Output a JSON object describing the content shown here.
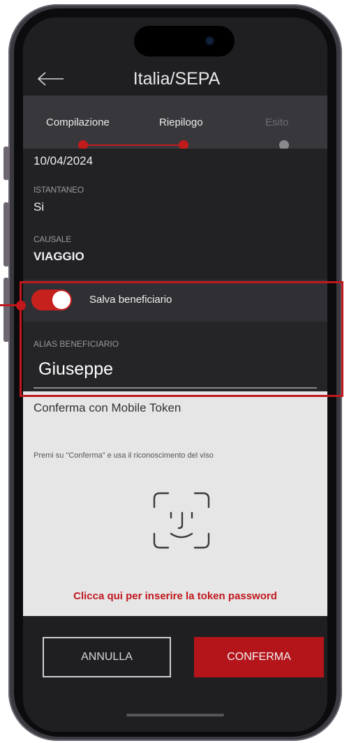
{
  "header": {
    "title": "Italia/SEPA",
    "back_icon": "arrow-left-icon"
  },
  "steps": [
    {
      "label": "Compilazione",
      "state": "done"
    },
    {
      "label": "Riepilogo",
      "state": "active"
    },
    {
      "label": "Esito",
      "state": "pending"
    }
  ],
  "summary": {
    "date": "10/04/2024",
    "instant_label": "ISTANTANEO",
    "instant_value": "Si",
    "reason_label": "CAUSALE",
    "reason_value": "VIAGGIO"
  },
  "save_beneficiary": {
    "label": "Salva beneficiario",
    "enabled": true
  },
  "alias": {
    "label": "ALIAS BENEFICIARIO",
    "value": "Giuseppe"
  },
  "token": {
    "title": "Conferma con Mobile Token",
    "hint": "Premi su \"Conferma\" e usa il riconoscimento del viso",
    "face_icon": "face-id-icon",
    "link": "Clicca qui per inserire la token password"
  },
  "buttons": {
    "cancel": "ANNULLA",
    "confirm": "CONFERMA"
  },
  "colors": {
    "accent": "#c0181d",
    "background": "#1f1f22",
    "panel": "#e6e6e7"
  }
}
